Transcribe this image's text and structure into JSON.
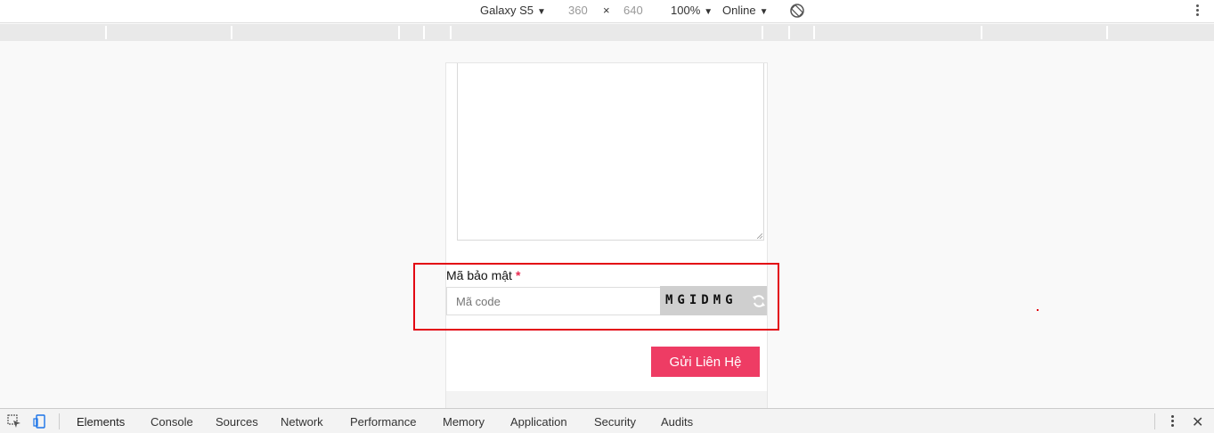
{
  "device_toolbar": {
    "device": "Galaxy S5",
    "width": "360",
    "times": "×",
    "height": "640",
    "zoom": "100%",
    "throttle": "Online",
    "caret": "▼"
  },
  "form": {
    "security_label": "Mã bảo mật",
    "required_mark": "*",
    "code_placeholder": "Mã code",
    "captcha_text": "MGIDMG",
    "submit_label": "Gửi Liên Hệ"
  },
  "devtools": {
    "tabs": [
      "Elements",
      "Console",
      "Sources",
      "Network",
      "Performance",
      "Memory",
      "Application",
      "Security",
      "Audits"
    ],
    "close": "✕"
  },
  "colors": {
    "submit": "#ee3c64",
    "highlight": "#e30613",
    "required": "#e8294f"
  }
}
